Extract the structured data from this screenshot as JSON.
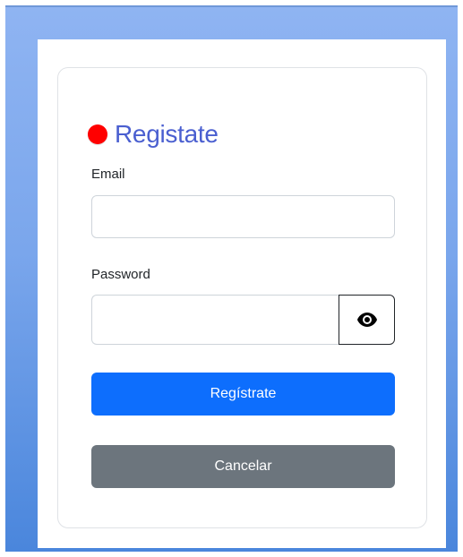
{
  "form": {
    "title": "Registate",
    "email_label": "Email",
    "email_value": "",
    "password_label": "Password",
    "password_value": "",
    "toggle_icon": "eye-icon",
    "submit_label": "Regístrate",
    "cancel_label": "Cancelar"
  },
  "colors": {
    "title": "#4a5fd0",
    "status_dot": "#ff0000",
    "primary": "#0d6efd",
    "secondary": "#6c757d"
  }
}
